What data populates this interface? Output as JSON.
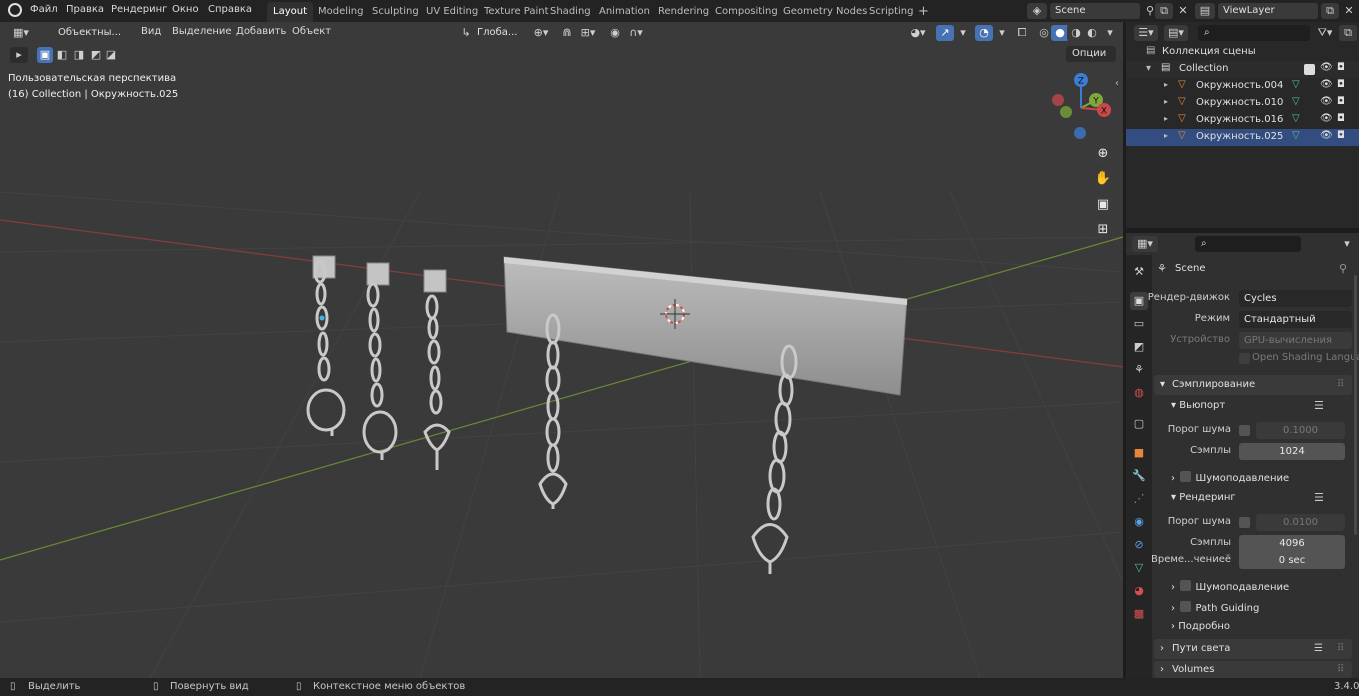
{
  "topbar": {
    "menus": [
      "Файл",
      "Правка",
      "Рендеринг",
      "Окно",
      "Справка"
    ],
    "workspaces": [
      "Layout",
      "Modeling",
      "Sculpting",
      "UV Editing",
      "Texture Paint",
      "Shading",
      "Animation",
      "Rendering",
      "Compositing",
      "Geometry Nodes",
      "Scripting"
    ],
    "active_workspace": "Layout",
    "add_tab": "+",
    "scene": "Scene",
    "view_layer": "ViewLayer"
  },
  "viewport_header": {
    "mode": "Объектны...",
    "menus": [
      "Вид",
      "Выделение",
      "Добавить",
      "Объект"
    ],
    "orientation": "Глоба...",
    "options": "Опции"
  },
  "viewport_overlay": {
    "view_name": "Пользовательская перспектива",
    "object_info": "(16) Collection | Окружность.025",
    "gizmo_axes": [
      "Z",
      "Y",
      "X"
    ]
  },
  "outliner": {
    "scene_collection": "Коллекция сцены",
    "collection": "Collection",
    "objects": [
      "Окружность.004",
      "Окружность.010",
      "Окружность.016",
      "Окружность.025"
    ]
  },
  "properties": {
    "scene_name": "Scene",
    "render_engine_label": "Рендер-движок",
    "render_engine": "Cycles",
    "mode_label": "Режим",
    "mode": "Стандартный",
    "device_label": "Устройство",
    "device": "GPU-вычисления",
    "osl_label": "Open Shading Language",
    "sampling": "Сэмплирование",
    "viewport": "Вьюпорт",
    "noise_threshold_label": "Порог шума",
    "viewport_noise_threshold": "0.1000",
    "samples_label": "Сэмплы",
    "viewport_samples": "1024",
    "denoise_label": "Шумоподавление",
    "rendering": "Рендеринг",
    "render_noise_threshold": "0.0100",
    "render_samples": "4096",
    "time_limit_label": "Време...чениеё",
    "time_limit": "0 sec",
    "path_guiding": "Path Guiding",
    "advanced": "Подробно",
    "light_paths": "Пути света",
    "volumes": "Volumes"
  },
  "statusbar": {
    "select": "Выделить",
    "rotate": "Повернуть вид",
    "context": "Контекстное меню объектов",
    "version": "3.4.0"
  },
  "colors": {
    "accent_blue": "#4772b3",
    "axis_x": "#c8484b",
    "axis_y": "#7fa83a",
    "axis_z": "#3c7dd6",
    "viewport_bg": "#3a3a3a"
  }
}
